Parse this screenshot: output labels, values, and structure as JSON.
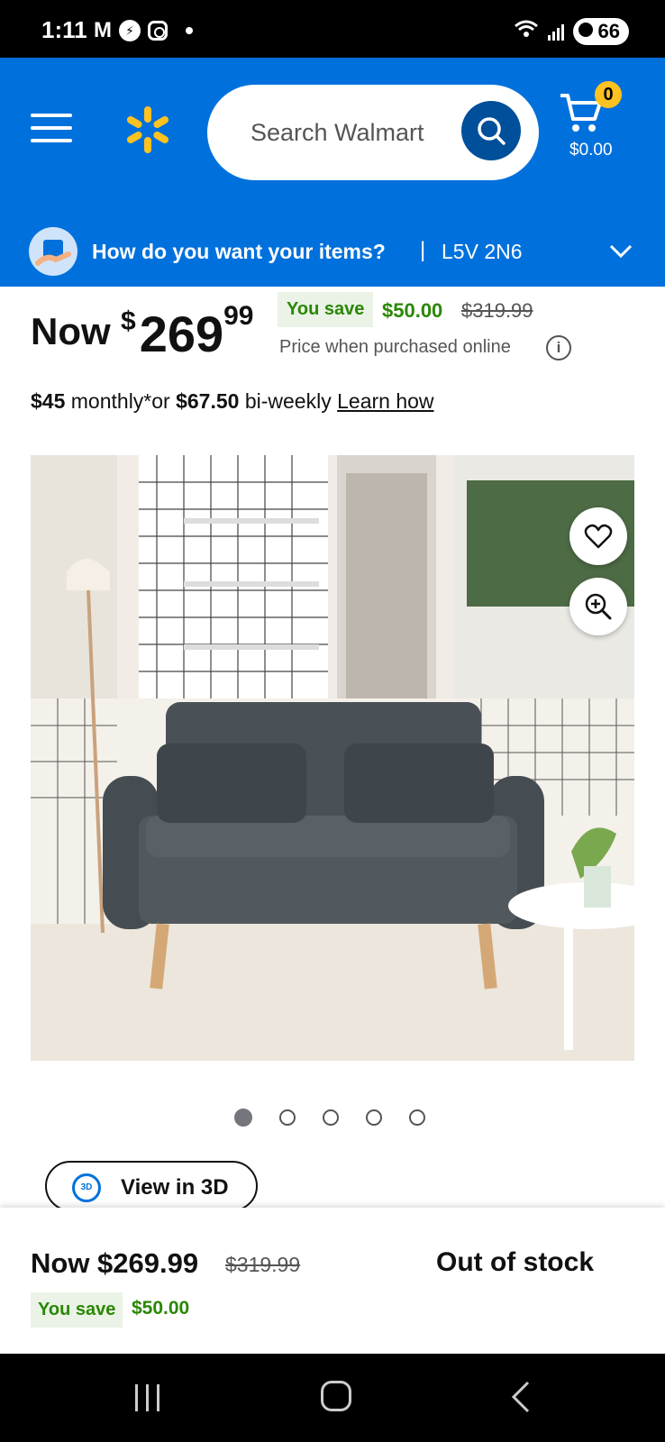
{
  "status_bar": {
    "time": "1:11",
    "battery": "66"
  },
  "header": {
    "search_placeholder": "Search Walmart",
    "cart_count": "0",
    "cart_total": "$0.00"
  },
  "delivery": {
    "prompt": "How do you want your items?",
    "separator": "|",
    "zip": "L5V 2N6"
  },
  "price": {
    "now_label": "Now",
    "currency": "$",
    "dollars": "269",
    "cents": "99",
    "you_save_label": "You save",
    "save_amount": "$50.00",
    "was_price": "$319.99",
    "note": "Price when purchased online",
    "info_symbol": "i"
  },
  "financing": {
    "monthly_amount": "$45",
    "monthly_text": " monthly*or ",
    "biweekly_amount": "$67.50",
    "biweekly_text": " bi-weekly ",
    "learn_link": "Learn how"
  },
  "carousel": {
    "count": 5,
    "active_index": 0
  },
  "view3d": {
    "label": "View in 3D",
    "badge": "3D"
  },
  "sticky": {
    "now_text": "Now $269.99",
    "was_price": "$319.99",
    "you_save_label": "You save",
    "save_amount": "$50.00",
    "stock_status": "Out of stock"
  },
  "colors": {
    "brand_blue": "#0071dc",
    "spark_yellow": "#ffc220",
    "save_green": "#2a8703"
  }
}
